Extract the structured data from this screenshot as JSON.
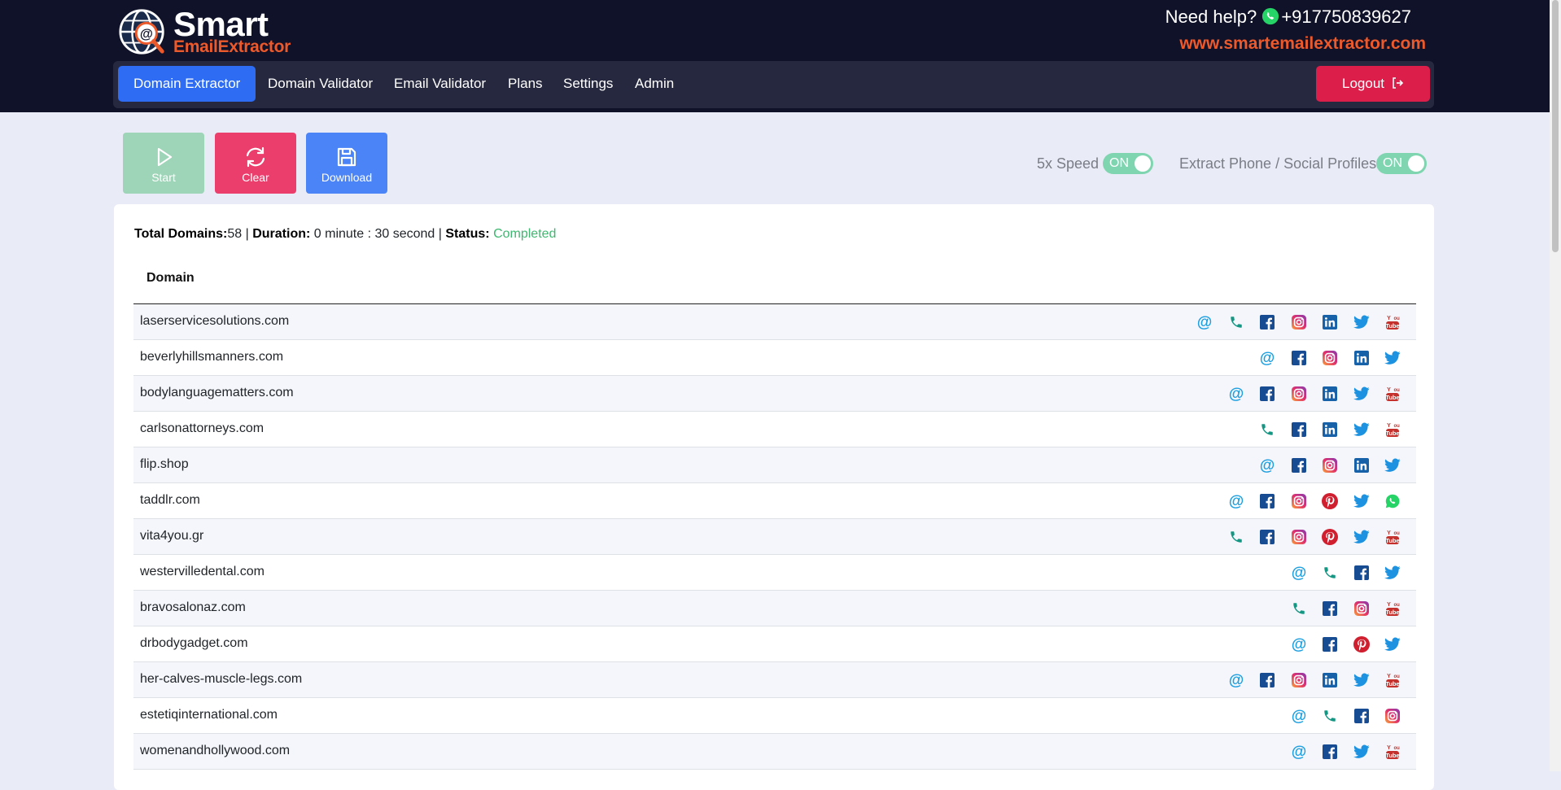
{
  "header": {
    "logo": {
      "word1": "Smart",
      "word2": "EmailExtractor"
    },
    "help_text": "Need help?",
    "phone": "+917750839627",
    "website": "www.smartemailextractor.com"
  },
  "nav": {
    "items": [
      {
        "label": "Domain Extractor",
        "active": true
      },
      {
        "label": "Domain Validator"
      },
      {
        "label": "Email Validator"
      },
      {
        "label": "Plans"
      },
      {
        "label": "Settings"
      },
      {
        "label": "Admin"
      }
    ],
    "logout": "Logout"
  },
  "actions": {
    "start": "Start",
    "clear": "Clear",
    "download": "Download"
  },
  "toggles": {
    "speed": {
      "label": "5x Speed",
      "state": "ON"
    },
    "extract": {
      "label": "Extract Phone / Social Profiles",
      "state": "ON"
    }
  },
  "summary": {
    "total_label": "Total Domains:",
    "total": "58",
    "duration_label": "Duration:",
    "duration": "0 minute : 30 second",
    "status_label": "Status:",
    "status": "Completed"
  },
  "table": {
    "header": "Domain",
    "rows": [
      {
        "domain": "laserservicesolutions.com",
        "icons": [
          "email",
          "phone",
          "facebook",
          "instagram",
          "linkedin",
          "twitter",
          "youtube"
        ]
      },
      {
        "domain": "beverlyhillsmanners.com",
        "icons": [
          "email",
          "facebook",
          "instagram",
          "linkedin",
          "twitter"
        ]
      },
      {
        "domain": "bodylanguagematters.com",
        "icons": [
          "email",
          "facebook",
          "instagram",
          "linkedin",
          "twitter",
          "youtube"
        ]
      },
      {
        "domain": "carlsonattorneys.com",
        "icons": [
          "phone",
          "facebook",
          "linkedin",
          "twitter",
          "youtube"
        ]
      },
      {
        "domain": "flip.shop",
        "icons": [
          "email",
          "facebook",
          "instagram",
          "linkedin",
          "twitter"
        ]
      },
      {
        "domain": "taddlr.com",
        "icons": [
          "email",
          "facebook",
          "instagram",
          "pinterest",
          "twitter",
          "whatsapp"
        ]
      },
      {
        "domain": "vita4you.gr",
        "icons": [
          "phone",
          "facebook",
          "instagram",
          "pinterest",
          "twitter",
          "youtube"
        ]
      },
      {
        "domain": "westervilledental.com",
        "icons": [
          "email",
          "phone",
          "facebook",
          "twitter"
        ]
      },
      {
        "domain": "bravosalonaz.com",
        "icons": [
          "phone",
          "facebook",
          "instagram",
          "youtube"
        ]
      },
      {
        "domain": "drbodygadget.com",
        "icons": [
          "email",
          "facebook",
          "pinterest",
          "twitter"
        ]
      },
      {
        "domain": "her-calves-muscle-legs.com",
        "icons": [
          "email",
          "facebook",
          "instagram",
          "linkedin",
          "twitter",
          "youtube"
        ]
      },
      {
        "domain": "estetiqinternational.com",
        "icons": [
          "email",
          "phone",
          "facebook",
          "instagram"
        ]
      },
      {
        "domain": "womenandhollywood.com",
        "icons": [
          "email",
          "facebook",
          "twitter",
          "youtube"
        ]
      }
    ]
  }
}
